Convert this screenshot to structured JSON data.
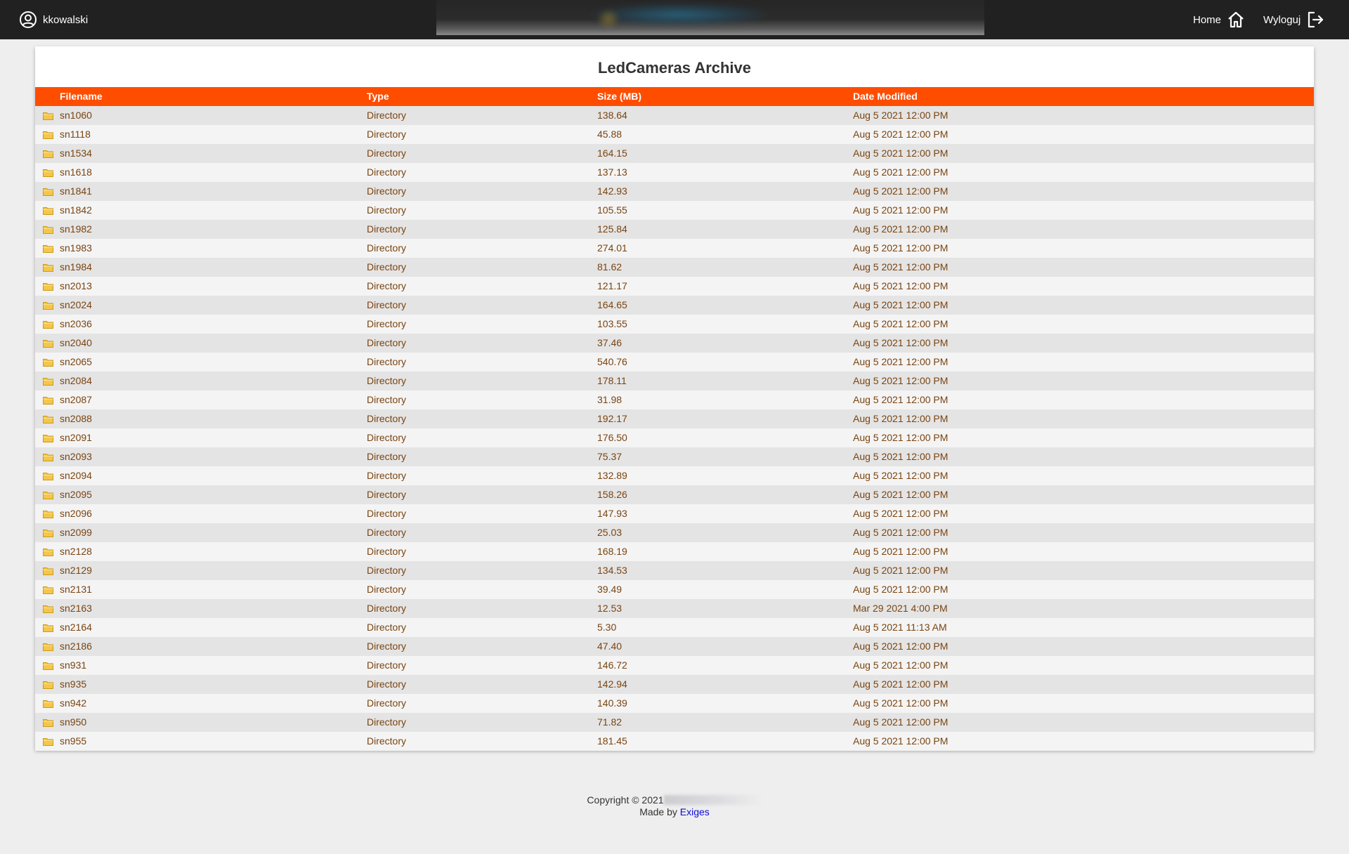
{
  "header": {
    "user_icon": "user-circle-icon",
    "username": "kkowalski",
    "home_label": "Home",
    "home_icon": "home-icon",
    "logout_label": "Wyloguj",
    "logout_icon": "logout-icon"
  },
  "archive": {
    "title": "LedCameras Archive",
    "folder_icon": "folder-icon",
    "columns": {
      "filename": "Filename",
      "type": "Type",
      "size": "Size (MB)",
      "date": "Date Modified"
    },
    "rows": [
      {
        "name": "sn1060",
        "type": "Directory",
        "size": "138.64",
        "date": "Aug 5 2021 12:00 PM"
      },
      {
        "name": "sn1118",
        "type": "Directory",
        "size": "45.88",
        "date": "Aug 5 2021 12:00 PM"
      },
      {
        "name": "sn1534",
        "type": "Directory",
        "size": "164.15",
        "date": "Aug 5 2021 12:00 PM"
      },
      {
        "name": "sn1618",
        "type": "Directory",
        "size": "137.13",
        "date": "Aug 5 2021 12:00 PM"
      },
      {
        "name": "sn1841",
        "type": "Directory",
        "size": "142.93",
        "date": "Aug 5 2021 12:00 PM"
      },
      {
        "name": "sn1842",
        "type": "Directory",
        "size": "105.55",
        "date": "Aug 5 2021 12:00 PM"
      },
      {
        "name": "sn1982",
        "type": "Directory",
        "size": "125.84",
        "date": "Aug 5 2021 12:00 PM"
      },
      {
        "name": "sn1983",
        "type": "Directory",
        "size": "274.01",
        "date": "Aug 5 2021 12:00 PM"
      },
      {
        "name": "sn1984",
        "type": "Directory",
        "size": "81.62",
        "date": "Aug 5 2021 12:00 PM"
      },
      {
        "name": "sn2013",
        "type": "Directory",
        "size": "121.17",
        "date": "Aug 5 2021 12:00 PM"
      },
      {
        "name": "sn2024",
        "type": "Directory",
        "size": "164.65",
        "date": "Aug 5 2021 12:00 PM"
      },
      {
        "name": "sn2036",
        "type": "Directory",
        "size": "103.55",
        "date": "Aug 5 2021 12:00 PM"
      },
      {
        "name": "sn2040",
        "type": "Directory",
        "size": "37.46",
        "date": "Aug 5 2021 12:00 PM"
      },
      {
        "name": "sn2065",
        "type": "Directory",
        "size": "540.76",
        "date": "Aug 5 2021 12:00 PM"
      },
      {
        "name": "sn2084",
        "type": "Directory",
        "size": "178.11",
        "date": "Aug 5 2021 12:00 PM"
      },
      {
        "name": "sn2087",
        "type": "Directory",
        "size": "31.98",
        "date": "Aug 5 2021 12:00 PM"
      },
      {
        "name": "sn2088",
        "type": "Directory",
        "size": "192.17",
        "date": "Aug 5 2021 12:00 PM"
      },
      {
        "name": "sn2091",
        "type": "Directory",
        "size": "176.50",
        "date": "Aug 5 2021 12:00 PM"
      },
      {
        "name": "sn2093",
        "type": "Directory",
        "size": "75.37",
        "date": "Aug 5 2021 12:00 PM"
      },
      {
        "name": "sn2094",
        "type": "Directory",
        "size": "132.89",
        "date": "Aug 5 2021 12:00 PM"
      },
      {
        "name": "sn2095",
        "type": "Directory",
        "size": "158.26",
        "date": "Aug 5 2021 12:00 PM"
      },
      {
        "name": "sn2096",
        "type": "Directory",
        "size": "147.93",
        "date": "Aug 5 2021 12:00 PM"
      },
      {
        "name": "sn2099",
        "type": "Directory",
        "size": "25.03",
        "date": "Aug 5 2021 12:00 PM"
      },
      {
        "name": "sn2128",
        "type": "Directory",
        "size": "168.19",
        "date": "Aug 5 2021 12:00 PM"
      },
      {
        "name": "sn2129",
        "type": "Directory",
        "size": "134.53",
        "date": "Aug 5 2021 12:00 PM"
      },
      {
        "name": "sn2131",
        "type": "Directory",
        "size": "39.49",
        "date": "Aug 5 2021 12:00 PM"
      },
      {
        "name": "sn2163",
        "type": "Directory",
        "size": "12.53",
        "date": "Mar 29 2021 4:00 PM"
      },
      {
        "name": "sn2164",
        "type": "Directory",
        "size": "5.30",
        "date": "Aug 5 2021 11:13 AM"
      },
      {
        "name": "sn2186",
        "type": "Directory",
        "size": "47.40",
        "date": "Aug 5 2021 12:00 PM"
      },
      {
        "name": "sn931",
        "type": "Directory",
        "size": "146.72",
        "date": "Aug 5 2021 12:00 PM"
      },
      {
        "name": "sn935",
        "type": "Directory",
        "size": "142.94",
        "date": "Aug 5 2021 12:00 PM"
      },
      {
        "name": "sn942",
        "type": "Directory",
        "size": "140.39",
        "date": "Aug 5 2021 12:00 PM"
      },
      {
        "name": "sn950",
        "type": "Directory",
        "size": "71.82",
        "date": "Aug 5 2021 12:00 PM"
      },
      {
        "name": "sn955",
        "type": "Directory",
        "size": "181.45",
        "date": "Aug 5 2021 12:00 PM"
      }
    ]
  },
  "footer": {
    "copyright": "Copyright © 2021",
    "made_by_prefix": "Made by",
    "made_by_link": "Exiges"
  },
  "colors": {
    "topbar": "#212121",
    "table_header": "#ff4d00",
    "row_text": "#7a4411",
    "link": "#0b0bd6",
    "page_background": "#eeeeee"
  }
}
